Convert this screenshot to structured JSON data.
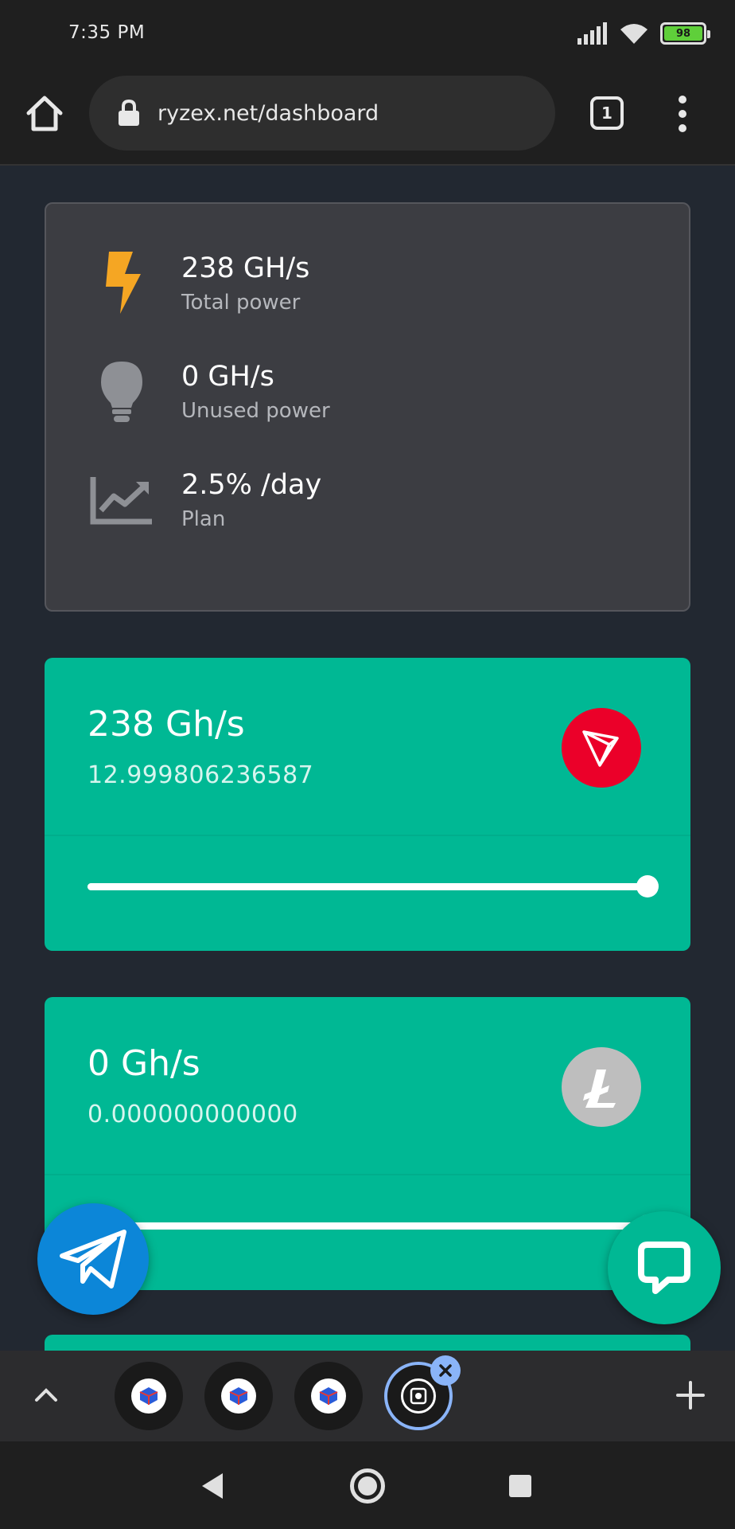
{
  "status_bar": {
    "time": "7:35 PM",
    "battery": "98"
  },
  "browser": {
    "url": "ryzex.net/dashboard",
    "tab_count": "1"
  },
  "stats": [
    {
      "value": "238 GH/s",
      "label": "Total power",
      "icon": "lightning-icon"
    },
    {
      "value": "0 GH/s",
      "label": "Unused power",
      "icon": "lightbulb-icon"
    },
    {
      "value": "2.5% /day",
      "label": "Plan",
      "icon": "chart-line-icon"
    }
  ],
  "coins": [
    {
      "rate": "238 Gh/s",
      "amount": "12.999806236587",
      "icon": "tron-icon",
      "color": "#eb0029",
      "slider_fraction": 1.0
    },
    {
      "rate": "0 Gh/s",
      "amount": "0.000000000000",
      "icon": "litecoin-icon",
      "color": "#bebebe",
      "slider_fraction": 1.0
    }
  ],
  "colors": {
    "accent": "#00b894",
    "telegram": "#0c86d8",
    "card_bg": "#3c3d42",
    "page_bg": "#222831"
  }
}
